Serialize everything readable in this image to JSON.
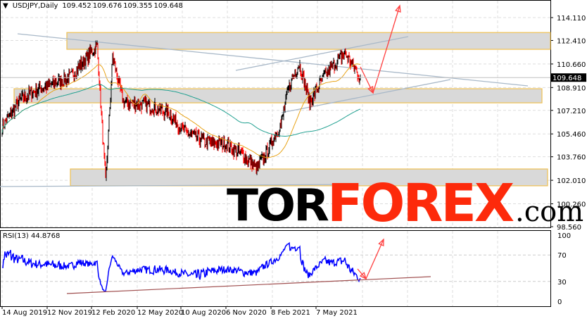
{
  "header": {
    "symbol": "USDJPY,Daily",
    "open": "109.452",
    "high": "109.676",
    "low": "109.355",
    "close": "109.648"
  },
  "rsi_header": "RSI(13) 44.8768",
  "current_price": "109.648",
  "logo": {
    "part1": "TOR",
    "part2": "FOREX",
    "part3": ".com"
  },
  "colors": {
    "bull": "#000000",
    "bear": "#ff0000",
    "ma_fast": "#e8a317",
    "ma_slow": "#20a090",
    "rsi": "#0000ff",
    "zone": "#d9d9d9",
    "zone_border": "#f0c050",
    "arrow": "#ff4040",
    "logo_red": "#fd2a0b"
  },
  "chart_data": {
    "type": "candlestick",
    "title": "USDJPY,Daily",
    "price_axis": [
      "114.110",
      "112.410",
      "110.660",
      "108.910",
      "107.210",
      "105.460",
      "103.760",
      "102.010",
      "100.260",
      "98.560"
    ],
    "ylim": [
      98.56,
      114.11
    ],
    "rsi_axis": [
      "100",
      "70",
      "30",
      "0"
    ],
    "time_axis": [
      "14 Aug 2019",
      "12 Nov 2019",
      "12 Feb 2020",
      "12 May 2020",
      "10 Aug 2020",
      "6 Nov 2020",
      "8 Feb 2021",
      "7 May 2021"
    ],
    "keypoints": [
      [
        0,
        106.0
      ],
      [
        27,
        108.1
      ],
      [
        57,
        108.9
      ],
      [
        97,
        109.7
      ],
      [
        135,
        112.0
      ],
      [
        147,
        101.8
      ],
      [
        157,
        111.2
      ],
      [
        172,
        107.8
      ],
      [
        207,
        107.6
      ],
      [
        237,
        107.0
      ],
      [
        257,
        105.7
      ],
      [
        287,
        104.9
      ],
      [
        317,
        104.7
      ],
      [
        342,
        103.9
      ],
      [
        362,
        102.9
      ],
      [
        377,
        104.2
      ],
      [
        397,
        106.3
      ],
      [
        407,
        108.9
      ],
      [
        422,
        110.7
      ],
      [
        437,
        107.8
      ],
      [
        457,
        109.7
      ],
      [
        487,
        111.5
      ],
      [
        509,
        109.6
      ]
    ],
    "zones": [
      [
        111.75,
        113.0
      ],
      [
        107.77,
        108.82
      ],
      [
        101.6,
        102.85
      ]
    ]
  }
}
